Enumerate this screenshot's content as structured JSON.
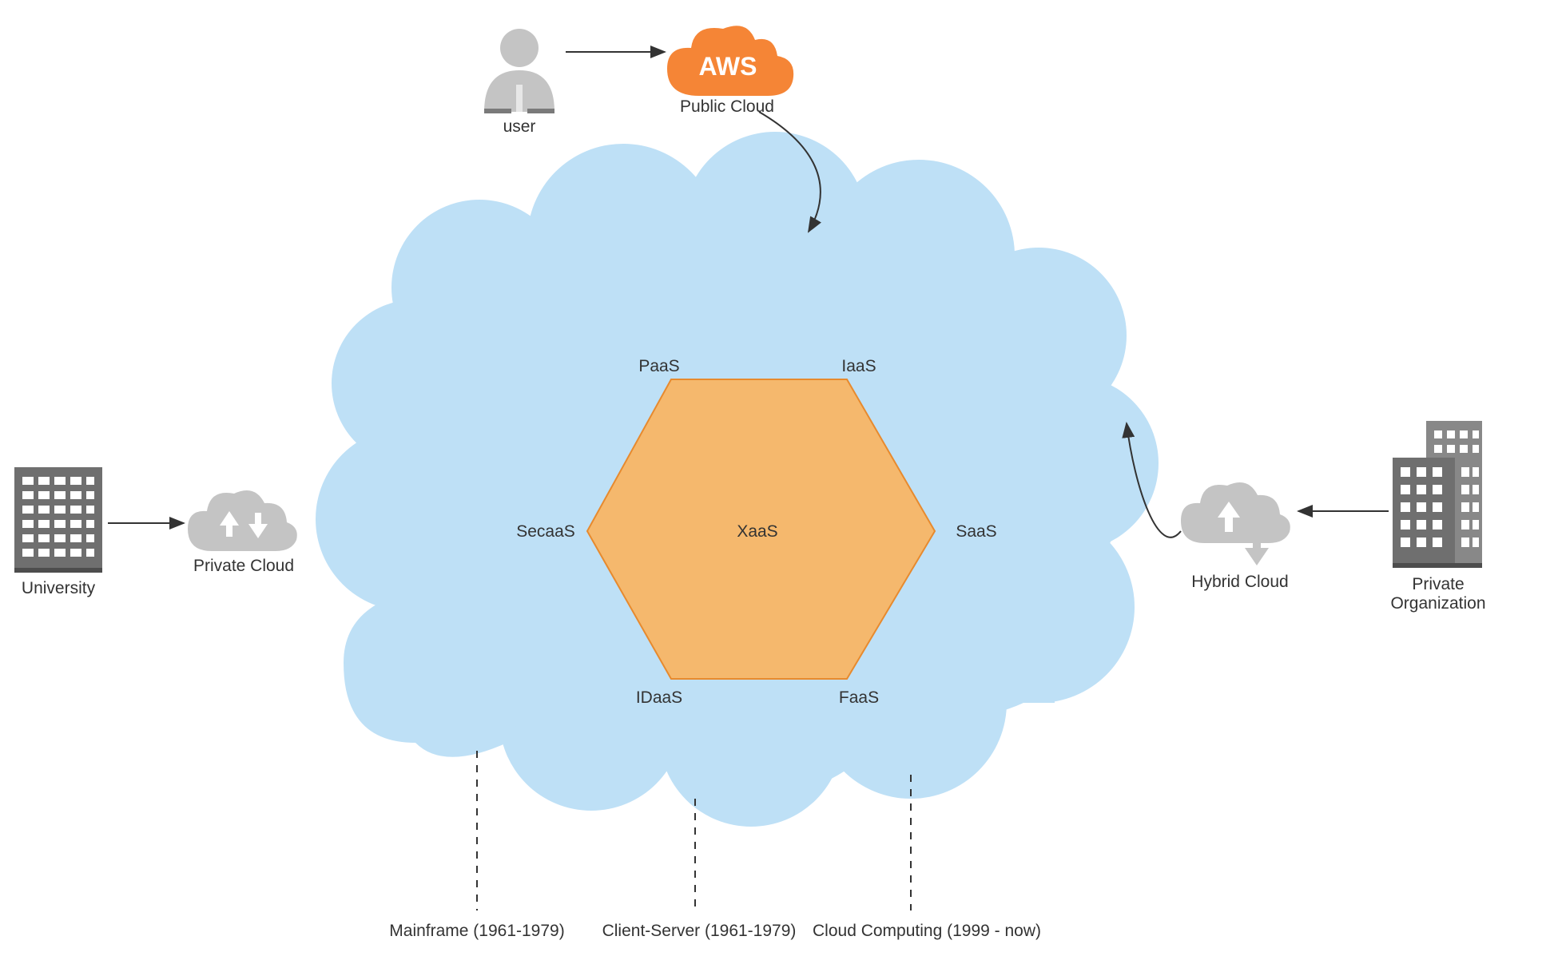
{
  "colors": {
    "cloud_fill": "#bee0f6",
    "hexagon_fill": "#f5b86d",
    "hexagon_stroke": "#e78a2e",
    "aws_orange": "#f58536",
    "icon_gray": "#c4c4c4",
    "icon_gray_dark": "#7a7a7a",
    "building_gray": "#6f6f6f",
    "text": "#333333"
  },
  "nodes": {
    "user": {
      "label": "user"
    },
    "public_cloud": {
      "label": "Public Cloud",
      "brand": "AWS"
    },
    "university": {
      "label": "University"
    },
    "private_cloud": {
      "label": "Private Cloud"
    },
    "hybrid_cloud": {
      "label": "Hybrid Cloud"
    },
    "private_org": {
      "label": "Private\nOrganization"
    }
  },
  "hexagon": {
    "center": "XaaS",
    "vertices": [
      "PaaS",
      "IaaS",
      "SaaS",
      "FaaS",
      "IDaaS",
      "SecaaS"
    ]
  },
  "timeline": {
    "era1": "Mainframe (1961-1979)",
    "era2": "Client-Server (1961-1979)",
    "era3": "Cloud Computing (1999 - now)"
  }
}
